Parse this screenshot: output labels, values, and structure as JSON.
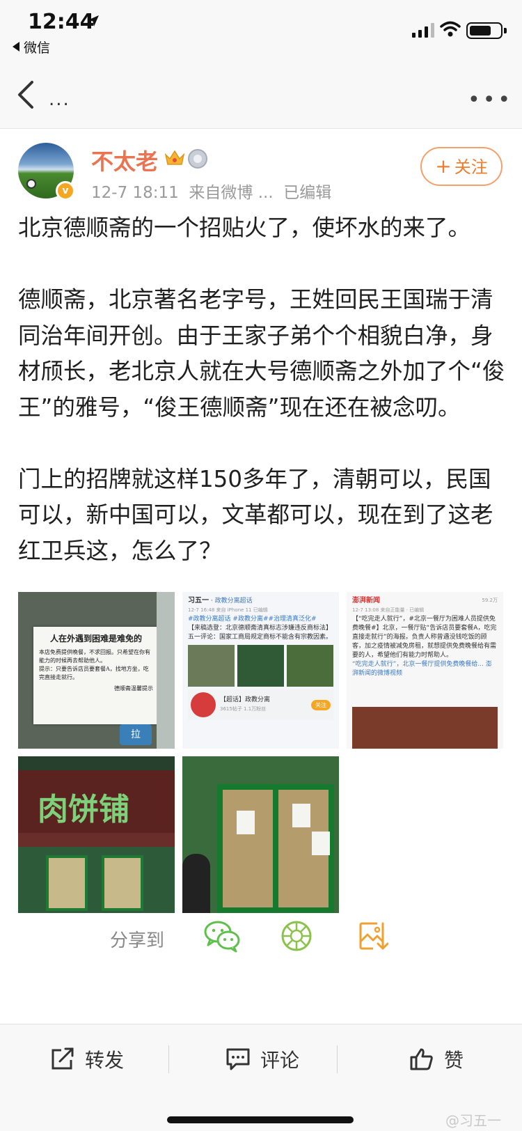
{
  "status_bar": {
    "time": "12:44",
    "back_app": "微信"
  },
  "nav": {
    "more_left": "...",
    "more_right": "•••"
  },
  "post": {
    "username": "不太老",
    "timestamp": "12-7 18:11",
    "source": "来自微博 ...",
    "edited": "已编辑",
    "follow_label": "关注",
    "paragraphs": [
      "北京德顺斋的一个招贴火了，使坏水的来了。",
      "德顺斋，北京著名老字号，王姓回民王国瑞于清同治年间开创。由于王家子弟个个相貌白净，身材颀长，老北京人就在大号德顺斋之外加了个“俊王”的雅号，“俊王德顺斋”现在还在被念叨。",
      "门上的招牌就这样150多年了，清朝可以，民国可以，新中国可以，文革都可以，现在到了这老红卫兵这，怎么了？"
    ]
  },
  "images": {
    "img1": {
      "title": "人在外遇到困难是难免的",
      "body": "本店免费提供晚餐，不求回报。只希望在你有能力的时候再去帮助他人。",
      "hint": "提示：只要告诉店员要套餐A，找地方坐，吃完直接走就行。",
      "sign": "德顺斋温馨提示",
      "door_text": "拉"
    },
    "img2": {
      "user": "习五一",
      "tag_head": "政教分离超话",
      "time": "12-7 16:48 来自 iPhone 11 已编辑",
      "tags": "#政教分离超话 #政教分离##治理清真泛化#",
      "text1": "【来稿选登：北京德顺斋清真标志涉嫌违反商标法】五一评论：国家工商局规定商标不能含有宗教因素。",
      "card_title": "【超话】政教分离",
      "card_sub": "3615帖子 1.1万粉丝",
      "card_btn": "关注"
    },
    "img3": {
      "user": "澎湃新闻",
      "time": "12-7 13:08 来自正能量 · 已编辑",
      "count": "59.2万",
      "text": "【“吃完走人就行”，#北京一餐厅为困难人员提供免费晚餐#】北京，一餐厅贴“告诉店员要套餐A，吃完直接走就行”的海报。负责人称曾遇没钱吃饭的顾客，加之疫情被减免房租，就想提供免费晚餐给有需要的人，希望他们有能力时帮助人。",
      "link": "“吃完走人就行”，北京一餐厅提供免费晚餐给... 澎湃新闻的微博视频"
    },
    "img4": {
      "shop_name": "肉饼铺"
    }
  },
  "share": {
    "label": "分享到"
  },
  "bottom_bar": {
    "repost": "转发",
    "comment": "评论",
    "like": "赞",
    "watermark": "@习五一"
  },
  "colors": {
    "username": "#eb7350",
    "follow": "#f07c2d",
    "wechat_green": "#5fbf4b",
    "save_orange": "#f0a030"
  }
}
